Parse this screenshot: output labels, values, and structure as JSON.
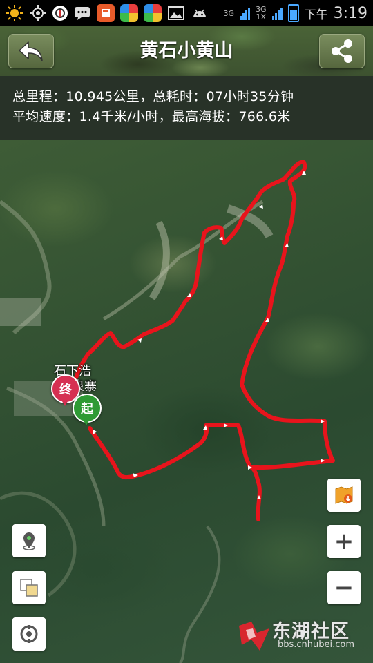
{
  "status_bar": {
    "icons": [
      "weather-sun-icon",
      "gps-icon",
      "clean-master-icon",
      "message-icon",
      "app-store-icon",
      "game-center-icon",
      "game-center-icon",
      "image-icon",
      "android-icon"
    ],
    "network_a": "3G",
    "network_b": "3G",
    "network_b_sub": "1X",
    "ampm": "下午",
    "time": "3:19"
  },
  "header": {
    "title": "黄石小黄山",
    "back_icon": "back-arrow-icon",
    "share_icon": "share-icon"
  },
  "stats": {
    "line1": "总里程：10.945公里，总耗时：07小时35分钟",
    "line2": "平均速度：1.4千米/小时，最高海拔：766.6米"
  },
  "map": {
    "place_label_line1": "石下浩",
    "place_label_line2": "泉寨",
    "end_marker": "终",
    "start_marker": "起",
    "route_color": "#e8141c"
  },
  "controls": {
    "left": [
      "location-pin-icon",
      "layers-icon",
      "compass-icon"
    ],
    "right": [
      "offline-map-icon",
      "zoom-in-icon",
      "zoom-out-icon"
    ],
    "zoom_in_label": "+",
    "zoom_out_label": "−"
  },
  "watermark": {
    "text": "东湖社区",
    "url": "bbs.cnhubei.com"
  }
}
